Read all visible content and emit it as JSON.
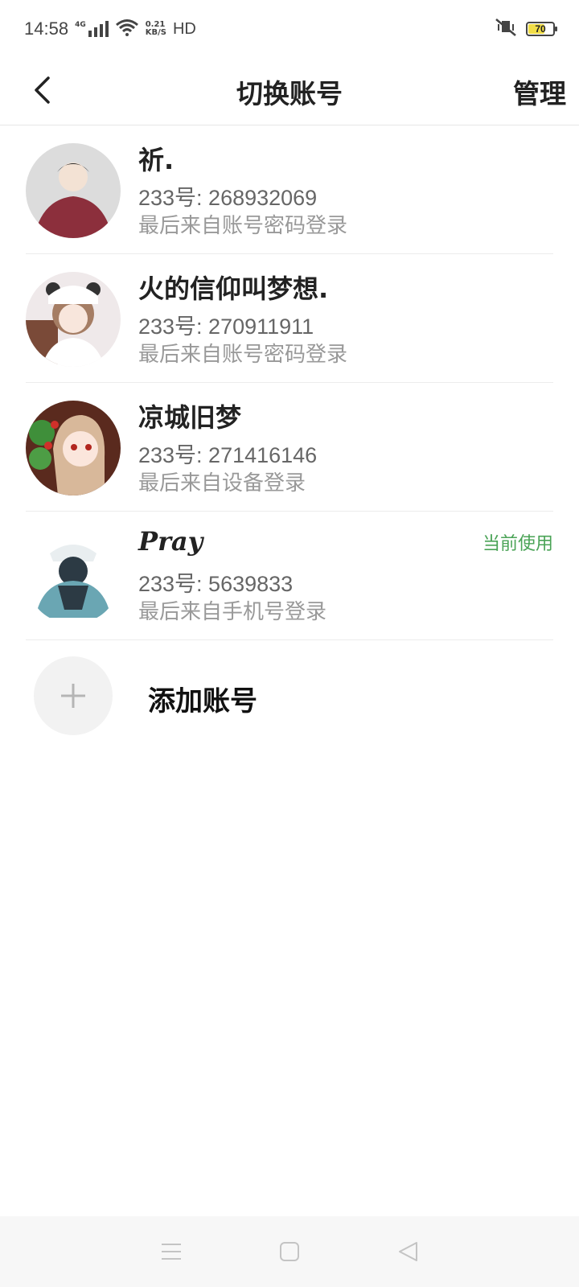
{
  "status_bar": {
    "time": "14:58",
    "net_type": "4G",
    "speed_value": "0.21",
    "speed_unit": "KB/S",
    "hd": "HD",
    "battery": "70",
    "battery_level": 0.7
  },
  "header": {
    "title": "切换账号",
    "manage": "管理"
  },
  "accounts": [
    {
      "name": "祈.",
      "id": "233号: 268932069",
      "login": "最后来自账号密码登录",
      "current": ""
    },
    {
      "name": "火的信仰叫梦想.",
      "id": "233号: 270911911",
      "login": "最后来自账号密码登录",
      "current": ""
    },
    {
      "name": "凉城旧梦",
      "id": "233号: 271416146",
      "login": "最后来自设备登录",
      "current": ""
    },
    {
      "name": "Pray",
      "id": "233号: 5639833",
      "login": "最后来自手机号登录",
      "current": "当前使用"
    }
  ],
  "add_account": {
    "label": "添加账号"
  },
  "colors": {
    "accent_green": "#4aa356",
    "battery_yellow": "#f1dd47"
  },
  "icons": [
    "back-icon",
    "signal-icon",
    "wifi-icon",
    "mute-vibrate-icon",
    "plus-icon",
    "menu-icon",
    "home-icon",
    "back-triangle-icon"
  ]
}
